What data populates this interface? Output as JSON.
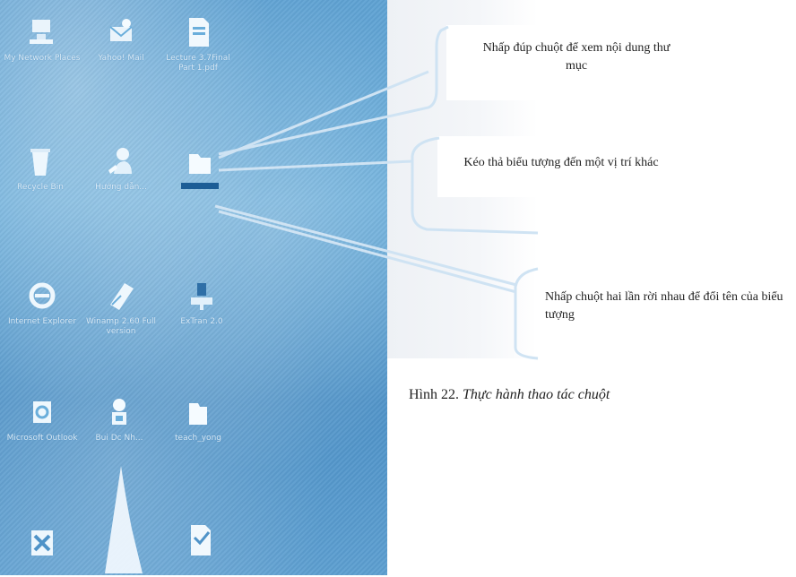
{
  "desktop": {
    "icons": [
      {
        "label": "My Network Places",
        "icon": "network-places-icon"
      },
      {
        "label": "Yahoo! Mail",
        "icon": "yahoo-mail-icon"
      },
      {
        "label": "Lecture 3.7Final Part 1.pdf",
        "icon": "pdf-file-icon"
      },
      {
        "label": "Recycle Bin",
        "icon": "recycle-bin-icon"
      },
      {
        "label": "Hướng dẫn...",
        "icon": "user-help-icon"
      },
      {
        "label": "",
        "icon": "folder-icon",
        "selected": true
      },
      {
        "label": "Internet Explorer",
        "icon": "internet-explorer-icon"
      },
      {
        "label": "Winamp 2.60 Full version",
        "icon": "winamp-icon"
      },
      {
        "label": "ExTran 2.0",
        "icon": "network-drive-icon"
      },
      {
        "label": "Microsoft Outlook",
        "icon": "outlook-icon"
      },
      {
        "label": "Bui Dc Nh...",
        "icon": "user-icon"
      },
      {
        "label": "teach_yong",
        "icon": "folder-icon"
      },
      {
        "label": "",
        "icon": "app-icon"
      },
      {
        "label": "",
        "icon": "folder-icon"
      },
      {
        "label": "",
        "icon": "document-icon"
      }
    ]
  },
  "annotations": {
    "double_click": "Nhấp đúp chuột để xem nội dung thư mục",
    "drag_drop": "Kéo thả biểu tượng đến một vị trí khác",
    "rename": "Nhấp chuột hai lần rời nhau để đổi tên của biểu tượng"
  },
  "caption": {
    "prefix": "Hình 22.",
    "title": "Thực hành thao tác chuột"
  },
  "colors": {
    "desktop_blue": "#5fa2d3",
    "callout_line": "#cfe3f3",
    "selection": "#1c5d96"
  }
}
